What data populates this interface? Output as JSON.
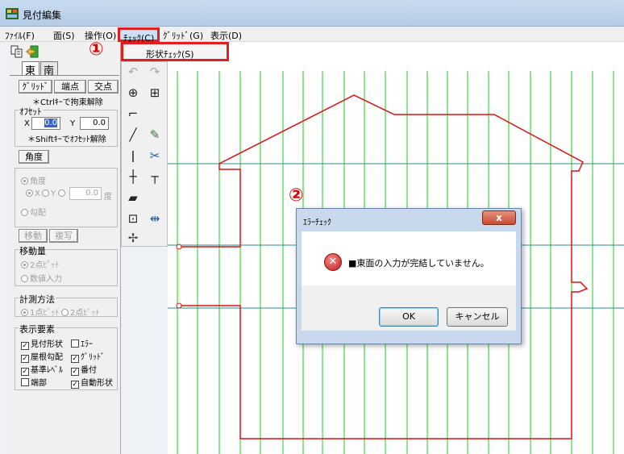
{
  "window": {
    "title": "見付編集"
  },
  "menu": {
    "items": [
      {
        "label": "ﾌｧｲﾙ(F)"
      },
      {
        "label": "面(S)"
      },
      {
        "label": "操作(O)"
      },
      {
        "label": "ﾁｪｯｸ(C)",
        "active": true
      },
      {
        "label": "ｸﾞﾘｯﾄﾞ(G)"
      },
      {
        "label": "表示(D)"
      }
    ],
    "check_dropdown": {
      "item": "形状ﾁｪｯｸ(S)"
    }
  },
  "annotations": {
    "step1": "①",
    "step2": "②"
  },
  "left_panel": {
    "tabs": [
      "東",
      "南"
    ],
    "snap_buttons": [
      "ｸﾞﾘｯﾄﾞ",
      "端点",
      "交点"
    ],
    "ctrl_hint": "＊Ctrlｷｰで拘束解除",
    "offset": {
      "title": "ｵﾌｾｯﾄ",
      "x_label": "X",
      "x_value": "0.0",
      "y_label": "Y",
      "y_value": "0.0",
      "shift_hint": "＊Shiftｷｰでｵﾌｾｯﾄ解除"
    },
    "angle_button": "角度",
    "angle_group": {
      "angle_option": "角度",
      "axis_x": "X",
      "axis_y": "Y",
      "angle_value": "0.0",
      "unit": "度",
      "slope_option": "勾配"
    },
    "move_button": "移動",
    "copy_button": "複写",
    "move_amount": {
      "title": "移動量",
      "option1": "2点ﾋﾟｯﾄ",
      "option2": "数値入力"
    },
    "measure": {
      "title": "計測方法",
      "option1": "1点ﾋﾟｯﾄ",
      "option2": "2点ﾋﾟｯﾄ"
    },
    "display": {
      "title": "表示要素",
      "items": [
        {
          "label": "見付形状",
          "checked": true
        },
        {
          "label": "ｴﾗｰ",
          "checked": false
        },
        {
          "label": "屋根勾配",
          "checked": true
        },
        {
          "label": "ｸﾞﾘｯﾄﾞ",
          "checked": true
        },
        {
          "label": "基準ﾚﾍﾞﾙ",
          "checked": true
        },
        {
          "label": "番付",
          "checked": true
        },
        {
          "label": "端部",
          "checked": false
        },
        {
          "label": "自動形状",
          "checked": true
        }
      ]
    }
  },
  "dialog": {
    "title": "ｴﾗｰﾁｪｯｸ",
    "message": "■東面の入力が完結していません。",
    "ok_label": "OK",
    "cancel_label": "キャンセル",
    "close_symbol": "x"
  },
  "colors": {
    "grid_vertical": "#22cc22",
    "grid_horizontal": "#2a8c8c",
    "outline": "#e01010",
    "highlight": "#e02020"
  }
}
